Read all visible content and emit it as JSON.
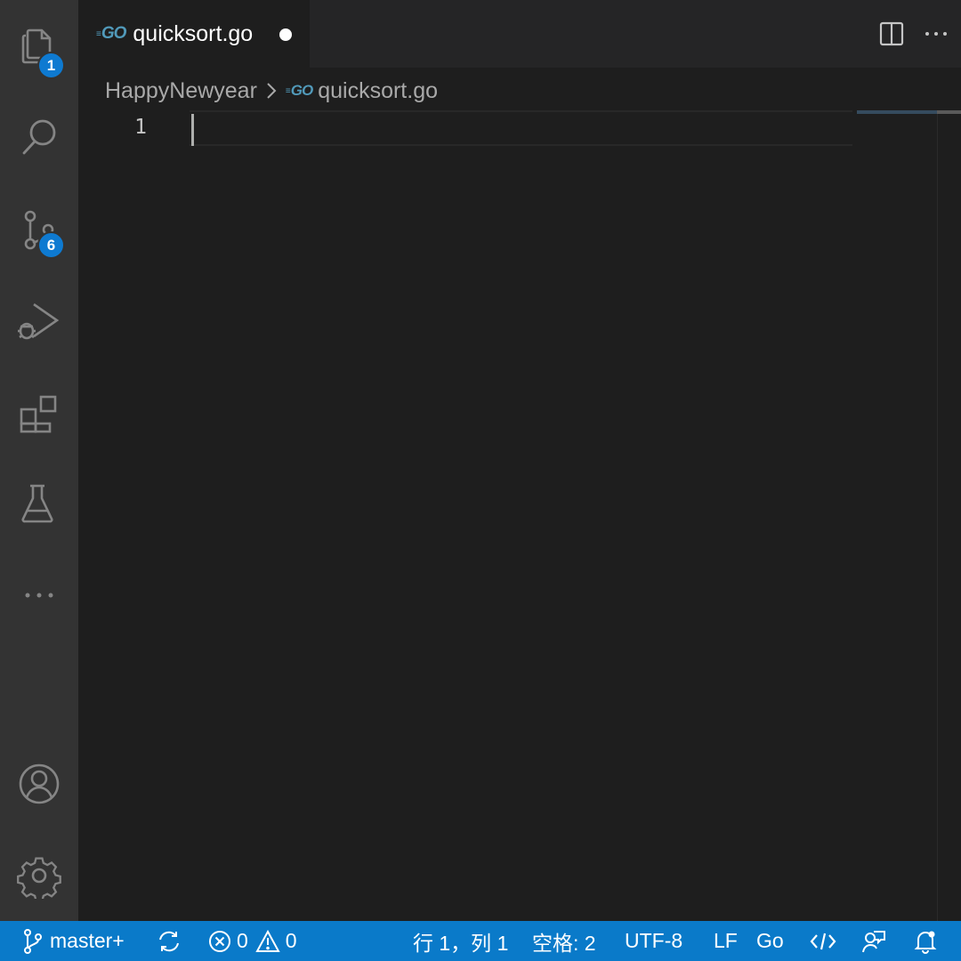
{
  "activity_bar": {
    "explorer_badge": "1",
    "source_control_badge": "6"
  },
  "tab": {
    "title": "quicksort.go",
    "file_icon": "GO"
  },
  "breadcrumb": {
    "folder": "HappyNewyear",
    "file": "quicksort.go",
    "file_icon": "GO"
  },
  "editor": {
    "line_number": "1"
  },
  "status_bar": {
    "branch": "master+",
    "errors": "0",
    "warnings": "0",
    "position": "行 1，列 1",
    "indent": "空格: 2",
    "encoding": "UTF-8",
    "eol": "LF",
    "language": "Go"
  },
  "colors": {
    "activity_bar": "#333333",
    "editor_bg": "#1e1e1e",
    "tabbar_bg": "#252526",
    "status_bar": "#0a7ac9",
    "badge": "#0e7ad1",
    "go_icon": "#519aba"
  }
}
